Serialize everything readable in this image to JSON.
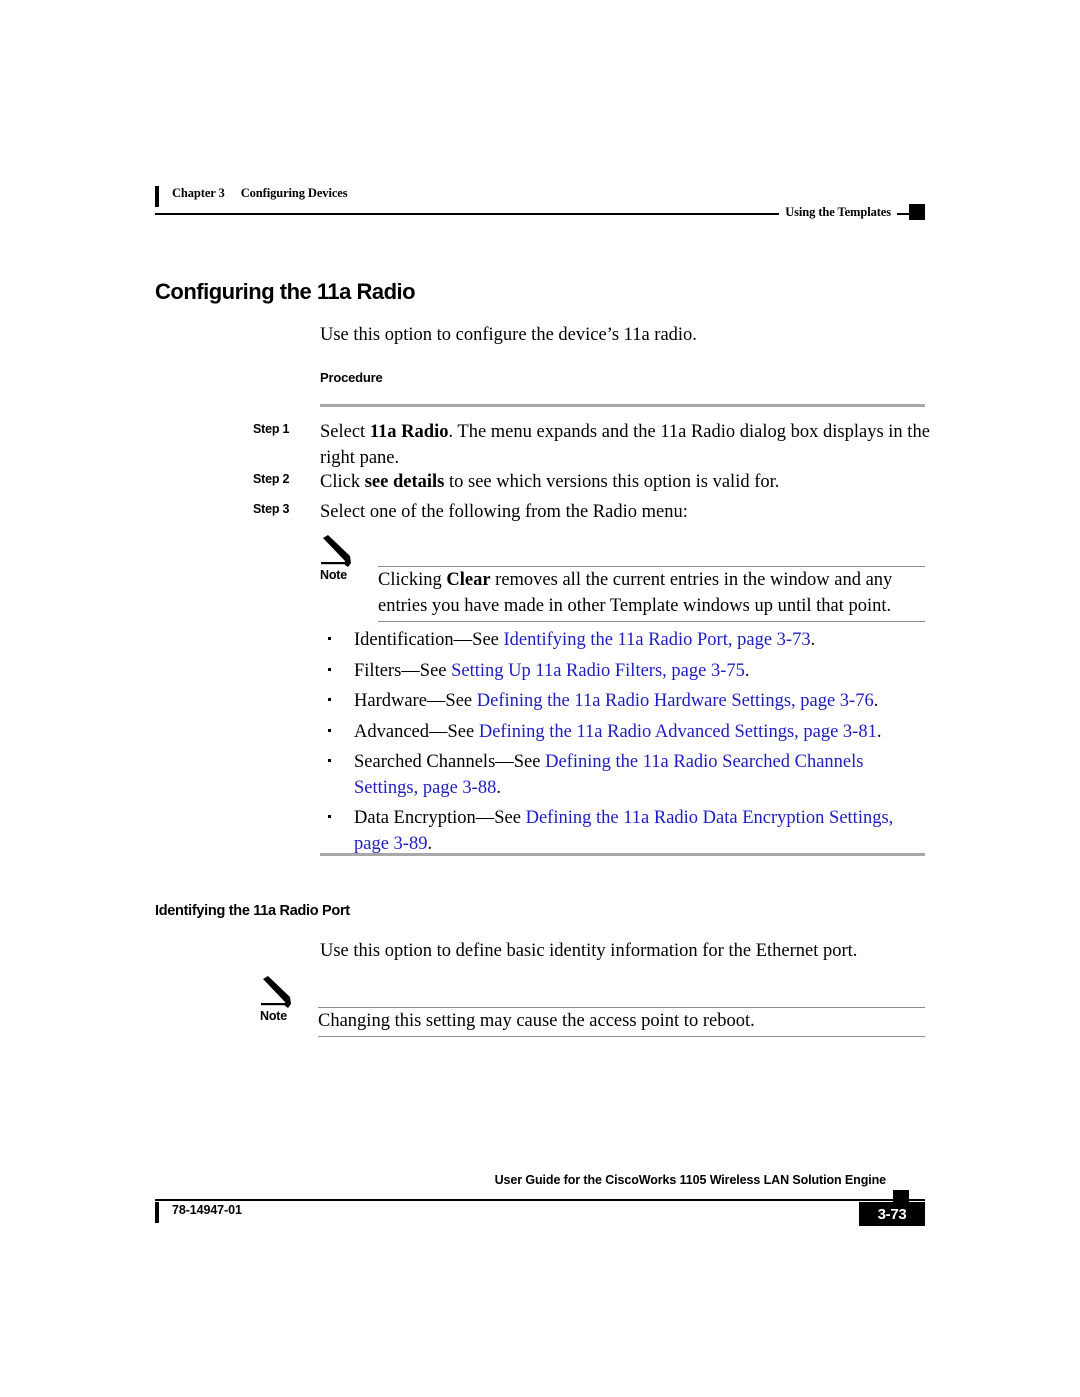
{
  "header": {
    "chapter_number": "Chapter 3",
    "chapter_title": "Configuring Devices",
    "section_title": "Using the Templates"
  },
  "section": {
    "title": "Configuring the 11a Radio",
    "intro": "Use this option to configure the device’s 11a radio.",
    "procedure_label": "Procedure"
  },
  "steps": [
    {
      "label": "Step 1",
      "text_1": "Select ",
      "bold_1": "11a Radio",
      "text_2": ". The menu expands and the 11a Radio dialog box displays in the right pane."
    },
    {
      "label": "Step 2",
      "text_1": "Click ",
      "bold_1": "see details",
      "text_2": " to see which versions this option is valid for."
    },
    {
      "label": "Step 3",
      "text_1": "Select one of the following from the Radio menu:",
      "bold_1": "",
      "text_2": ""
    }
  ],
  "note_1": {
    "label": "Note",
    "text_1": "Clicking ",
    "bold_1": "Clear",
    "text_2": " removes all the current entries in the window and any entries you have made in other Template windows up until that point."
  },
  "bullets": [
    {
      "lead": "Identification—See ",
      "link": "Identifying the 11a Radio Port, page 3-73",
      "tail": "."
    },
    {
      "lead": "Filters—See ",
      "link": "Setting Up 11a Radio Filters, page 3-75",
      "tail": "."
    },
    {
      "lead": "Hardware—See ",
      "link": "Defining the 11a Radio Hardware Settings, page 3-76",
      "tail": "."
    },
    {
      "lead": "Advanced—See ",
      "link": "Defining the 11a Radio Advanced Settings, page 3-81",
      "tail": "."
    },
    {
      "lead": "Searched Channels—See ",
      "link": "Defining the 11a Radio Searched Channels Settings, page 3-88",
      "tail": "."
    },
    {
      "lead": "Data Encryption—See ",
      "link": "Defining the 11a Radio Data Encryption Settings, page 3-89",
      "tail": "."
    }
  ],
  "subsection": {
    "title": "Identifying the 11a Radio Port",
    "intro": "Use this option to define basic identity information for the Ethernet port."
  },
  "note_2": {
    "label": "Note",
    "text_1": "Changing this setting may cause the access point to reboot.",
    "bold_1": "",
    "text_2": ""
  },
  "footer": {
    "doc_number": "78-14947-01",
    "guide_title": "User Guide for the CiscoWorks 1105 Wireless LAN Solution Engine",
    "page_number": "3-73"
  },
  "colors": {
    "link": "#1d1dc4",
    "rule_thick": "#a8a8a8",
    "rule_thin": "#8c8c8c",
    "ink": "#000000"
  }
}
